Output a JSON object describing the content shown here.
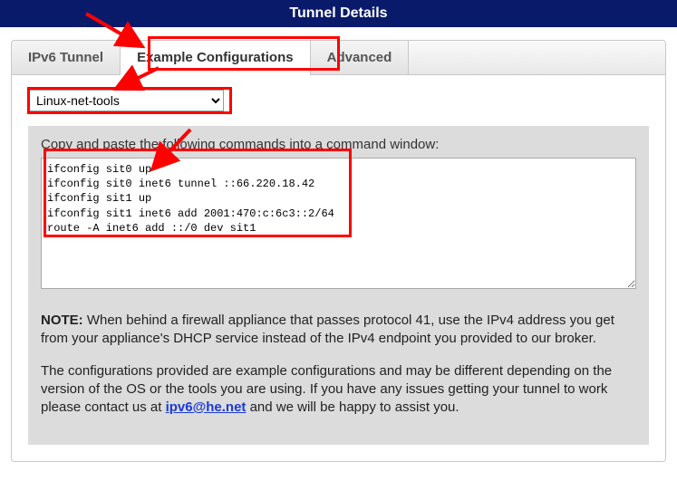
{
  "header": {
    "title": "Tunnel Details"
  },
  "tabs": {
    "items": [
      {
        "label": "IPv6 Tunnel"
      },
      {
        "label": "Example Configurations"
      },
      {
        "label": "Advanced"
      }
    ],
    "activeIndex": 1
  },
  "selector": {
    "value": "Linux-net-tools"
  },
  "box": {
    "instruction": "Copy and paste the following commands into a command window:",
    "commands": "ifconfig sit0 up\nifconfig sit0 inet6 tunnel ::66.220.18.42\nifconfig sit1 up\nifconfig sit1 inet6 add 2001:470:c:6c3::2/64\nroute -A inet6 add ::/0 dev sit1"
  },
  "note": {
    "label": "NOTE:",
    "p1": " When behind a firewall appliance that passes protocol 41, use the IPv4 address you get from your appliance's DHCP service instead of the IPv4 endpoint you provided to our broker.",
    "p2a": "The configurations provided are example configurations and may be different depending on the version of the OS or the tools you are using. If you have any issues getting your tunnel to work please contact us at ",
    "email": "ipv6@he.net",
    "p2b": " and we will be happy to assist you."
  }
}
